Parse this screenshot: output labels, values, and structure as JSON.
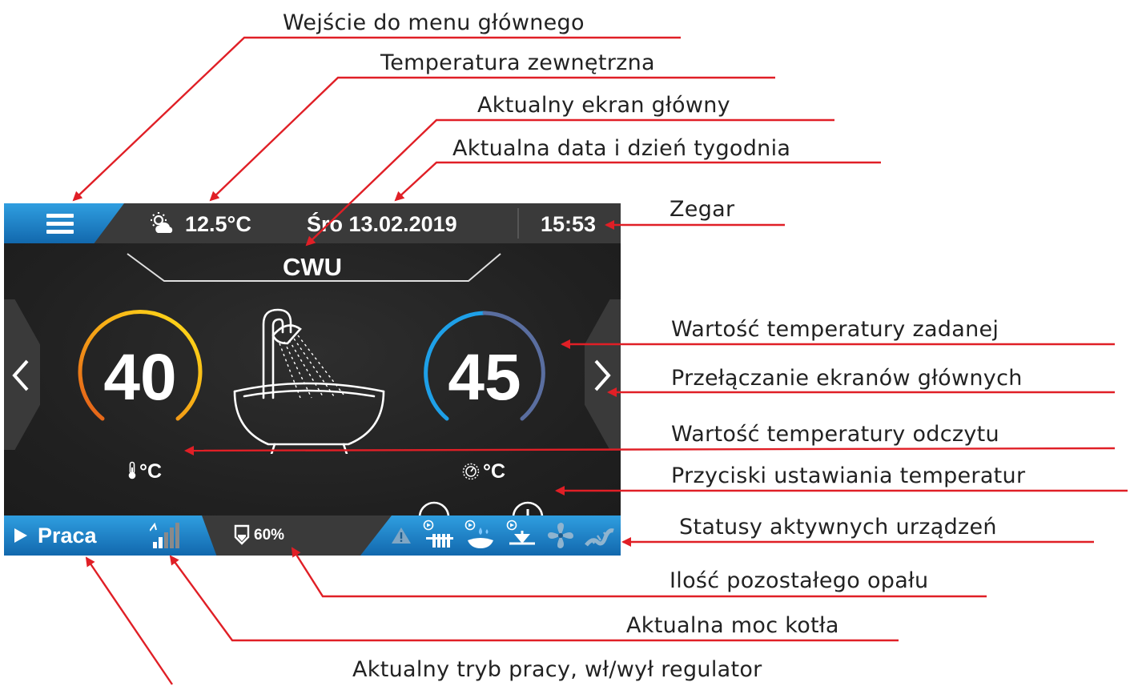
{
  "annotations": {
    "main_menu": "Wejście do menu głównego",
    "outdoor_temp": "Temperatura zewnętrzna",
    "current_screen": "Aktualny ekran główny",
    "date_day": "Aktualna data i dzień tygodnia",
    "clock": "Zegar",
    "set_temp": "Wartość temperatury zadanej",
    "switch_screens": "Przełączanie ekranów głównych",
    "read_temp": "Wartość temperatury odczytu",
    "temp_buttons": "Przyciski ustawiania temperatur",
    "device_status": "Statusy aktywnych urządzeń",
    "fuel_left": "Ilość pozostałego opału",
    "boiler_power": "Aktualna moc kotła",
    "mode": "Aktualny tryb pracy, wł/wył regulator"
  },
  "topbar": {
    "outdoor_temp": "12.5°C",
    "date": "Śro 13.02.2019",
    "clock": "15:53"
  },
  "screen": {
    "title": "CWU",
    "read_value": "40",
    "read_unit": "°C",
    "set_value": "45",
    "set_unit": "°C"
  },
  "bottombar": {
    "mode": "Praca",
    "fuel": "60%",
    "power_bars_lit": 2,
    "power_bars_total": 5
  },
  "colors": {
    "accent_blue": "#1a82cc",
    "annotation_red": "#e01f26",
    "read_arc_start": "#e35a1a",
    "read_arc_end": "#ffe01a",
    "set_arc_blue": "#1ea0e8",
    "set_arc_grey": "#5a6ea0"
  },
  "icons": {
    "menu": "hamburger-menu-icon",
    "weather": "sun-cloud-icon",
    "thermometer": "thermometer-icon",
    "setpoint": "dial-icon",
    "fuel": "fuel-hopper-icon",
    "power": "signal-bars-icon",
    "play": "play-icon",
    "status": [
      "warning-icon",
      "radiator-pump-icon",
      "hot-water-pump-icon",
      "mixer-valve-icon",
      "fan-icon",
      "feeder-icon"
    ]
  }
}
